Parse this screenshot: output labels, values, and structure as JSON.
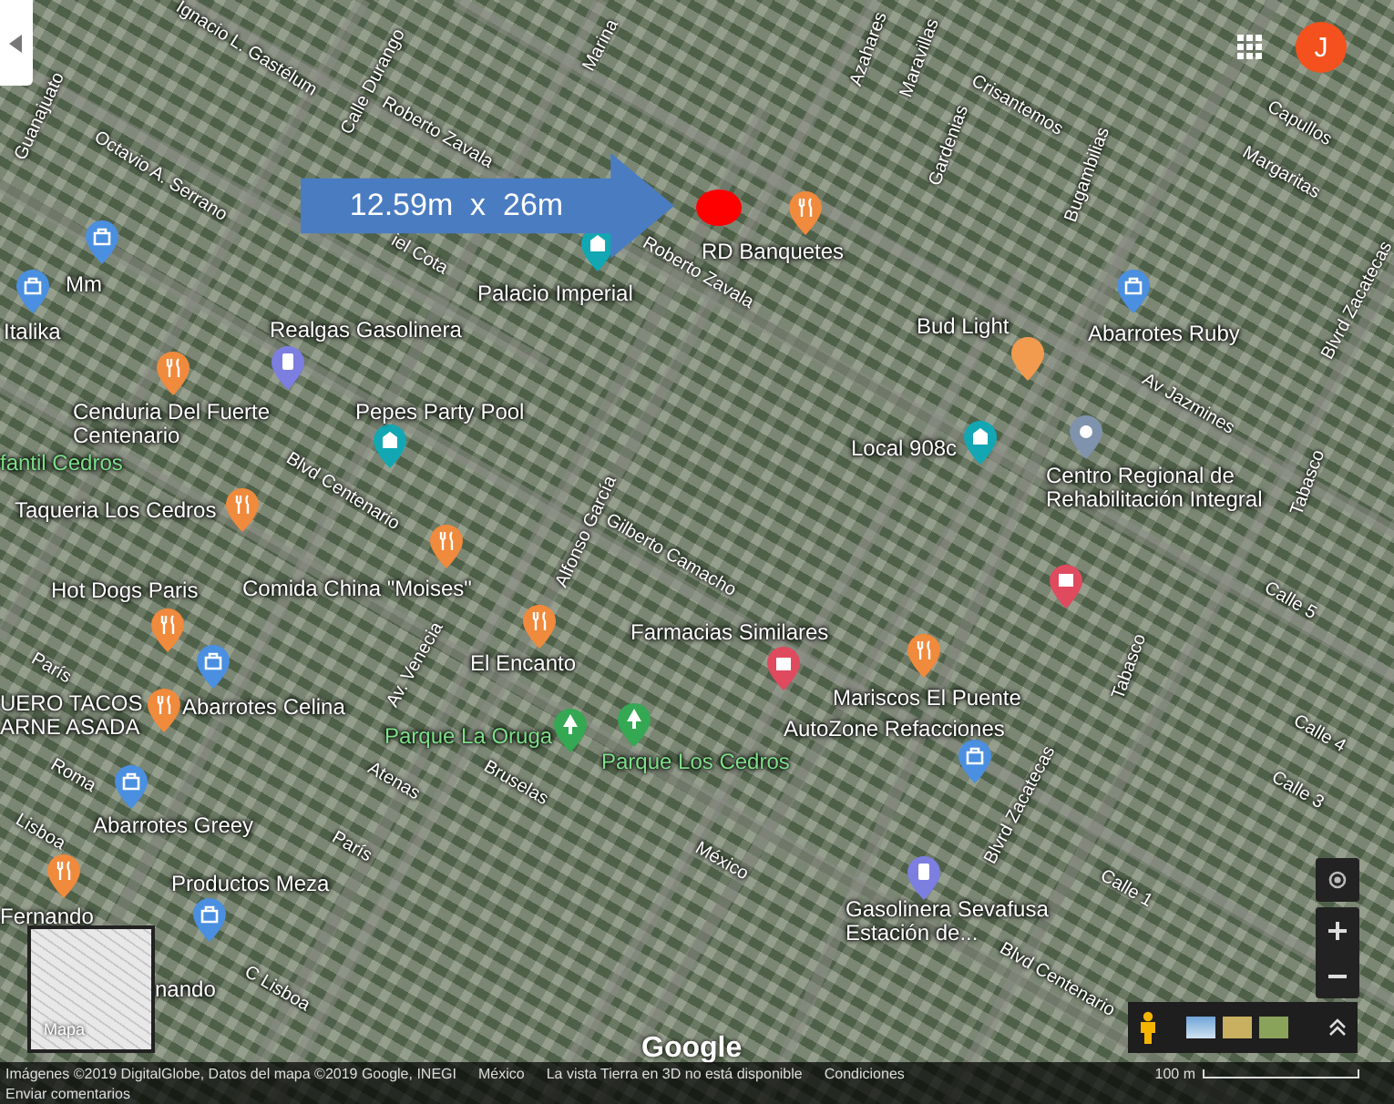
{
  "measurement": {
    "label": "12.59m  x  26m"
  },
  "places": [
    {
      "name": "RD Banquetes",
      "kind": "food"
    },
    {
      "name": "Palacio Imperial",
      "kind": "event"
    },
    {
      "name": "Bud Light",
      "kind": "generic"
    },
    {
      "name": "Abarrotes Ruby",
      "kind": "shop"
    },
    {
      "name": "Mm",
      "kind": "shop"
    },
    {
      "name": "Italika",
      "kind": "shop"
    },
    {
      "name": "Realgas Gasolinera",
      "kind": "gas"
    },
    {
      "name": "Cenduria Del Fuerte Centenario",
      "kind": "food"
    },
    {
      "name": "Pepes Party Pool",
      "kind": "event"
    },
    {
      "name": "Local 908c",
      "kind": "event"
    },
    {
      "name": "Centro Regional de Rehabilitación Integral",
      "kind": "info"
    },
    {
      "name": "fantil Cedros",
      "kind": "park"
    },
    {
      "name": "Taqueria Los Cedros",
      "kind": "food"
    },
    {
      "name": "Hot Dogs Paris",
      "kind": "food"
    },
    {
      "name": "Comida China \"Moises\"",
      "kind": "food"
    },
    {
      "name": "Farmacias Similares",
      "kind": "health"
    },
    {
      "name": "El Encanto",
      "kind": "food"
    },
    {
      "name": "UERO TACOS ARNE ASADA",
      "kind": "food"
    },
    {
      "name": "Abarrotes Celina",
      "kind": "shop"
    },
    {
      "name": "Mariscos El Puente",
      "kind": "food"
    },
    {
      "name": "Parque La Oruga",
      "kind": "park"
    },
    {
      "name": "AutoZone Refacciones",
      "kind": "shop"
    },
    {
      "name": "Parque Los Cedros",
      "kind": "park"
    },
    {
      "name": "Abarrotes Greey",
      "kind": "shop"
    },
    {
      "name": "Gasolinera Sevafusa Estación de...",
      "kind": "gas"
    },
    {
      "name": "Productos Meza",
      "kind": "shop"
    },
    {
      "name": "Fernando",
      "kind": "food"
    },
    {
      "name": "nando",
      "kind": "shop"
    }
  ],
  "unlabeled_pins": [
    {
      "kind": "health"
    }
  ],
  "streets": [
    "Ignacio L. Gastélum",
    "Calle Durango",
    "Roberto Zavala",
    "Guanajuato",
    "Octavio A. Serrano",
    "Marina",
    "iel Cota",
    "Roberto Zavala",
    "Azahares",
    "Maravillas",
    "Gardenias",
    "Crisantemos",
    "Bugambilias",
    "Capullos",
    "Margaritas",
    "Blvrd Zacatecas",
    "Av Jazmines",
    "Tabasco",
    "Blvd Centenario",
    "Alfonso García",
    "Gilberto Camacho",
    "Av. Venecia",
    "Bruselas",
    "Atenas",
    "París",
    "París",
    "Roma",
    "Lisboa",
    "C Lisboa",
    "México",
    "Blvrd Zacatecas",
    "Blvd Centenario",
    "Calle 5",
    "Calle 4",
    "Calle 3",
    "Calle 1",
    "Tabasco"
  ],
  "account": {
    "initial": "J"
  },
  "layer_switcher": {
    "label": "Mapa"
  },
  "logo": "Google",
  "footer": {
    "attribution": "Imágenes ©2019 DigitalGlobe, Datos del mapa ©2019 Google, INEGI",
    "region": "México",
    "notice": "La vista Tierra en 3D no está disponible",
    "terms": "Condiciones",
    "scale": "100 m",
    "feedback": "Enviar comentarios"
  }
}
